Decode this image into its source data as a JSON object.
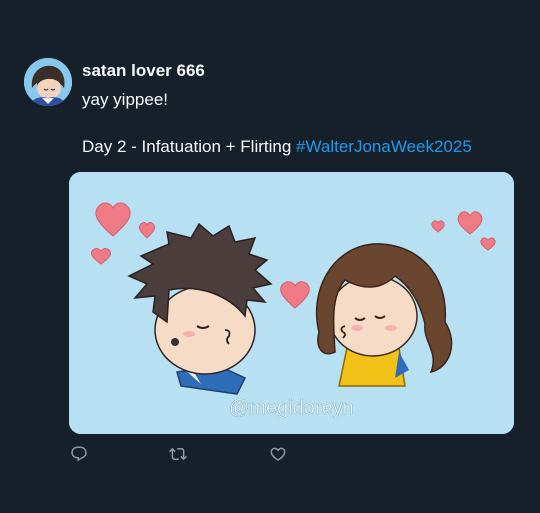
{
  "post": {
    "author_name": "satan lover 666",
    "text_line1": "yay yippee!",
    "text_line2_plain": "Day 2 - Infatuation + Flirting ",
    "hashtag": "#WalterJonaWeek2025",
    "image_watermark": "@megidoreyn"
  },
  "icons": {
    "reply": "reply-icon",
    "retweet": "retweet-icon",
    "like": "heart-icon"
  },
  "colors": {
    "background": "#15202b",
    "text": "#f7f9f9",
    "link": "#1d9bf0",
    "muted": "#8b98a5",
    "media_bg": "#b8e0f3",
    "heart": "#f07a85"
  }
}
